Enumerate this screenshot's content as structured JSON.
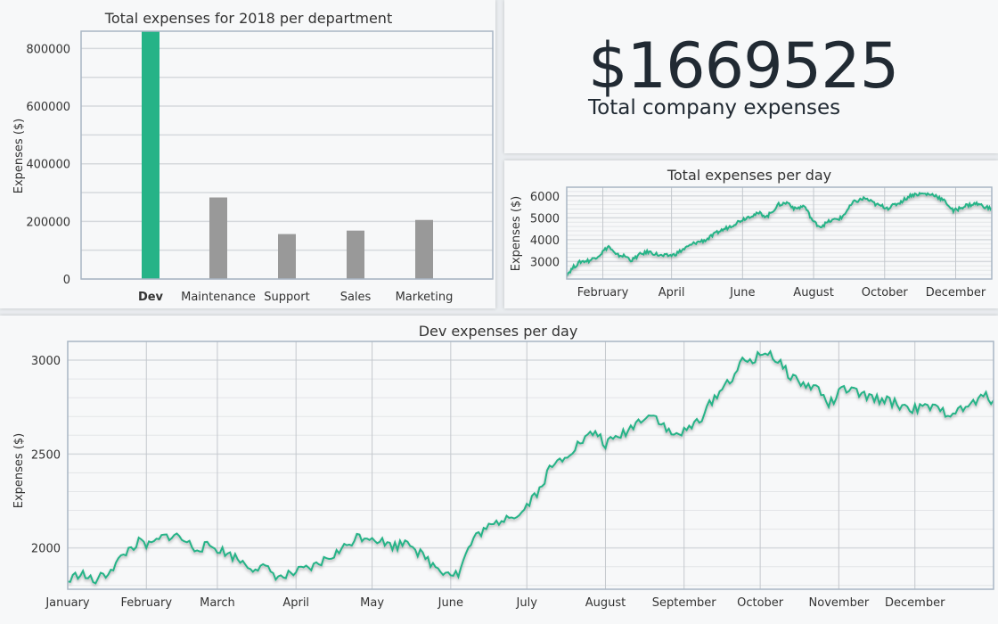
{
  "summary": {
    "total": "$1669525",
    "label": "Total company expenses"
  },
  "colors": {
    "accent": "#26b387",
    "bar_other": "#999999",
    "grid": "#d6d9dd",
    "axis": "#a9b6c4"
  },
  "chart_data": [
    {
      "type": "bar",
      "title": "Total expenses for 2018 per department",
      "ylabel": "Expenses ($)",
      "xlabel": "",
      "categories": [
        "Dev",
        "Maintenance",
        "Support",
        "Sales",
        "Marketing"
      ],
      "values": [
        865000,
        283000,
        156000,
        168000,
        205000
      ],
      "highlight": "Dev",
      "ylim": [
        0,
        860000
      ],
      "yticks": [
        0,
        200000,
        400000,
        600000,
        800000
      ],
      "grid": true
    },
    {
      "type": "line",
      "title": "Total expenses per day",
      "ylabel": "Expenses ($)",
      "xlabel": "",
      "x_range": [
        0,
        365
      ],
      "ylim": [
        2200,
        6400
      ],
      "yticks": [
        3000,
        4000,
        5000,
        6000
      ],
      "xticks": [
        {
          "label": "February",
          "x": 31
        },
        {
          "label": "April",
          "x": 90
        },
        {
          "label": "June",
          "x": 151
        },
        {
          "label": "August",
          "x": 212
        },
        {
          "label": "October",
          "x": 273
        },
        {
          "label": "December",
          "x": 334
        }
      ],
      "keypoints": [
        [
          0,
          2400
        ],
        [
          6,
          2750
        ],
        [
          12,
          3000
        ],
        [
          20,
          3050
        ],
        [
          28,
          3300
        ],
        [
          36,
          3700
        ],
        [
          42,
          3300
        ],
        [
          50,
          3250
        ],
        [
          56,
          3050
        ],
        [
          62,
          3300
        ],
        [
          70,
          3450
        ],
        [
          76,
          3350
        ],
        [
          82,
          3250
        ],
        [
          92,
          3300
        ],
        [
          100,
          3550
        ],
        [
          110,
          3850
        ],
        [
          120,
          4000
        ],
        [
          130,
          4350
        ],
        [
          140,
          4600
        ],
        [
          150,
          4900
        ],
        [
          158,
          5100
        ],
        [
          166,
          5200
        ],
        [
          172,
          5050
        ],
        [
          182,
          5600
        ],
        [
          190,
          5700
        ],
        [
          196,
          5400
        ],
        [
          204,
          5550
        ],
        [
          212,
          4800
        ],
        [
          218,
          4600
        ],
        [
          226,
          4850
        ],
        [
          236,
          5000
        ],
        [
          246,
          5700
        ],
        [
          256,
          5900
        ],
        [
          266,
          5600
        ],
        [
          276,
          5450
        ],
        [
          286,
          5700
        ],
        [
          296,
          6050
        ],
        [
          306,
          6100
        ],
        [
          316,
          6050
        ],
        [
          326,
          5700
        ],
        [
          332,
          5300
        ],
        [
          342,
          5550
        ],
        [
          352,
          5650
        ],
        [
          362,
          5450
        ],
        [
          365,
          5400
        ]
      ],
      "grid": true
    },
    {
      "type": "line",
      "title": "Dev expenses per day",
      "ylabel": "Expenses ($)",
      "xlabel": "",
      "x_range": [
        0,
        365
      ],
      "ylim": [
        1780,
        3100
      ],
      "yticks": [
        2000,
        2500,
        3000
      ],
      "xticks": [
        {
          "label": "January",
          "x": 0
        },
        {
          "label": "February",
          "x": 31
        },
        {
          "label": "March",
          "x": 59
        },
        {
          "label": "April",
          "x": 90
        },
        {
          "label": "May",
          "x": 120
        },
        {
          "label": "June",
          "x": 151
        },
        {
          "label": "July",
          "x": 181
        },
        {
          "label": "August",
          "x": 212
        },
        {
          "label": "September",
          "x": 243
        },
        {
          "label": "October",
          "x": 273
        },
        {
          "label": "November",
          "x": 304
        },
        {
          "label": "December",
          "x": 334
        }
      ],
      "keypoints": [
        [
          0,
          1820
        ],
        [
          5,
          1870
        ],
        [
          10,
          1820
        ],
        [
          15,
          1860
        ],
        [
          20,
          1930
        ],
        [
          24,
          1990
        ],
        [
          28,
          2030
        ],
        [
          32,
          2010
        ],
        [
          38,
          2060
        ],
        [
          42,
          2070
        ],
        [
          46,
          2040
        ],
        [
          50,
          2000
        ],
        [
          56,
          2010
        ],
        [
          60,
          1990
        ],
        [
          66,
          1950
        ],
        [
          72,
          1900
        ],
        [
          78,
          1890
        ],
        [
          84,
          1840
        ],
        [
          90,
          1870
        ],
        [
          96,
          1890
        ],
        [
          102,
          1940
        ],
        [
          108,
          1990
        ],
        [
          114,
          2060
        ],
        [
          120,
          2060
        ],
        [
          126,
          2020
        ],
        [
          130,
          2010
        ],
        [
          134,
          2050
        ],
        [
          138,
          1980
        ],
        [
          144,
          1910
        ],
        [
          148,
          1880
        ],
        [
          154,
          1860
        ],
        [
          158,
          2000
        ],
        [
          162,
          2080
        ],
        [
          168,
          2120
        ],
        [
          174,
          2180
        ],
        [
          178,
          2170
        ],
        [
          182,
          2250
        ],
        [
          186,
          2310
        ],
        [
          190,
          2420
        ],
        [
          196,
          2490
        ],
        [
          202,
          2560
        ],
        [
          208,
          2620
        ],
        [
          212,
          2550
        ],
        [
          218,
          2600
        ],
        [
          222,
          2640
        ],
        [
          228,
          2710
        ],
        [
          232,
          2700
        ],
        [
          238,
          2600
        ],
        [
          244,
          2620
        ],
        [
          250,
          2700
        ],
        [
          256,
          2820
        ],
        [
          262,
          2910
        ],
        [
          266,
          2990
        ],
        [
          270,
          3000
        ],
        [
          276,
          3050
        ],
        [
          280,
          2990
        ],
        [
          284,
          2930
        ],
        [
          290,
          2870
        ],
        [
          296,
          2850
        ],
        [
          300,
          2760
        ],
        [
          306,
          2850
        ],
        [
          312,
          2820
        ],
        [
          316,
          2800
        ],
        [
          322,
          2790
        ],
        [
          328,
          2760
        ],
        [
          334,
          2740
        ],
        [
          340,
          2750
        ],
        [
          346,
          2720
        ],
        [
          352,
          2730
        ],
        [
          358,
          2780
        ],
        [
          362,
          2810
        ],
        [
          365,
          2780
        ]
      ],
      "grid": true
    }
  ]
}
